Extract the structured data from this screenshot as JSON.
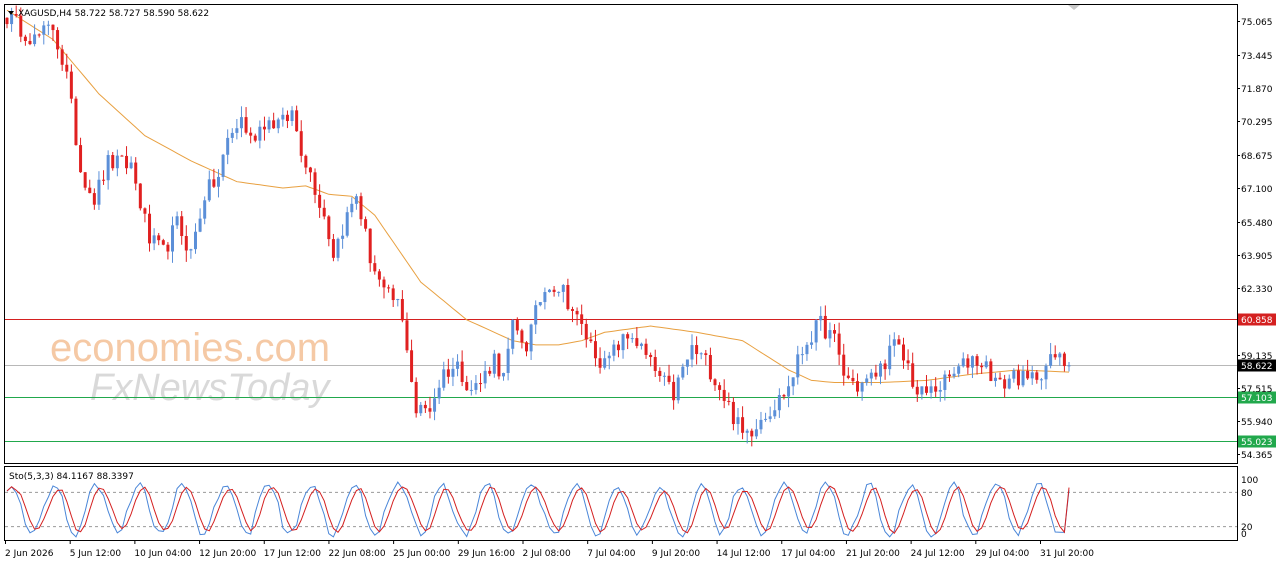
{
  "header": {
    "symbol_line": "XAGUSD,H4  58.722 58.727 58.590 58.622"
  },
  "watermark": {
    "line1": "economies.com",
    "line2": "FxNewsToday"
  },
  "colors": {
    "bull": "#5b8fd8",
    "bear": "#e02020",
    "ma": "#e8a040",
    "resistance": "#d42020",
    "support": "#21a84c",
    "stoch_main": "#4a86d8",
    "stoch_signal": "#d42020"
  },
  "chart_data": [
    {
      "type": "candlestick",
      "symbol": "XAGUSD",
      "timeframe": "H4",
      "ohlc_header": {
        "open": 58.722,
        "high": 58.727,
        "low": 58.59,
        "close": 58.622
      },
      "y_ticks": [
        75.065,
        73.445,
        71.87,
        70.295,
        68.675,
        67.1,
        65.48,
        63.905,
        62.33,
        59.135,
        57.515,
        55.94,
        54.365
      ],
      "ylim": [
        54.0,
        75.8
      ],
      "x_tick_labels": [
        "2 Jun 2026",
        "5 Jun 12:00",
        "10 Jun 04:00",
        "12 Jun 20:00",
        "17 Jun 12:00",
        "22 Jun 08:00",
        "25 Jun 00:00",
        "29 Jun 16:00",
        "2 Jul 08:00",
        "7 Jul 04:00",
        "9 Jul 20:00",
        "14 Jul 12:00",
        "17 Jul 04:00",
        "21 Jul 20:00",
        "24 Jul 12:00",
        "29 Jul 04:00",
        "31 Jul 20:00"
      ],
      "price_levels": [
        {
          "label": "60.858",
          "value": 60.858,
          "kind": "resistance"
        },
        {
          "label": "58.622",
          "value": 58.622,
          "kind": "current"
        },
        {
          "label": "57.103",
          "value": 57.103,
          "kind": "support"
        },
        {
          "label": "55.023",
          "value": 55.023,
          "kind": "support"
        }
      ],
      "close_path": [
        [
          0,
          75.3
        ],
        [
          6,
          74.2
        ],
        [
          10,
          74.8
        ],
        [
          13,
          72.4
        ],
        [
          16,
          68.0
        ],
        [
          19,
          66.6
        ],
        [
          22,
          68.3
        ],
        [
          27,
          68.2
        ],
        [
          31,
          64.6
        ],
        [
          34,
          64.0
        ],
        [
          37,
          65.4
        ],
        [
          40,
          64.0
        ],
        [
          43,
          66.8
        ],
        [
          46,
          67.6
        ],
        [
          48,
          69.4
        ],
        [
          51,
          70.4
        ],
        [
          53,
          69.4
        ],
        [
          56,
          70.3
        ],
        [
          60,
          70.2
        ],
        [
          62,
          70.7
        ],
        [
          64,
          69.0
        ],
        [
          66,
          67.8
        ],
        [
          69,
          65.8
        ],
        [
          71,
          64.0
        ],
        [
          73,
          65.2
        ],
        [
          76,
          66.8
        ],
        [
          79,
          63.8
        ],
        [
          82,
          62.0
        ],
        [
          85,
          61.6
        ],
        [
          87,
          59.6
        ],
        [
          89,
          56.4
        ],
        [
          92,
          56.6
        ],
        [
          95,
          58.3
        ],
        [
          98,
          58.6
        ],
        [
          101,
          57.5
        ],
        [
          103,
          57.8
        ],
        [
          106,
          59.0
        ],
        [
          108,
          58.0
        ],
        [
          110,
          60.4
        ],
        [
          113,
          59.6
        ],
        [
          116,
          61.8
        ],
        [
          118,
          62.6
        ],
        [
          121,
          62.2
        ],
        [
          124,
          60.8
        ],
        [
          127,
          59.6
        ],
        [
          130,
          58.6
        ],
        [
          133,
          59.6
        ],
        [
          136,
          60.1
        ],
        [
          139,
          59.0
        ],
        [
          142,
          58.0
        ],
        [
          145,
          57.2
        ],
        [
          147,
          58.4
        ],
        [
          149,
          59.4
        ],
        [
          152,
          58.8
        ],
        [
          155,
          57.6
        ],
        [
          158,
          56.2
        ],
        [
          160,
          55.3
        ],
        [
          162,
          55.6
        ],
        [
          164,
          56.2
        ],
        [
          167,
          56.7
        ],
        [
          170,
          57.6
        ],
        [
          172,
          58.8
        ],
        [
          174,
          59.8
        ],
        [
          177,
          60.6
        ],
        [
          180,
          59.8
        ],
        [
          182,
          58.2
        ],
        [
          185,
          57.6
        ],
        [
          188,
          58.0
        ],
        [
          190,
          58.5
        ],
        [
          193,
          59.6
        ],
        [
          196,
          58.6
        ],
        [
          198,
          57.2
        ],
        [
          201,
          57.4
        ],
        [
          204,
          57.8
        ],
        [
          207,
          58.4
        ],
        [
          210,
          59.0
        ],
        [
          213,
          58.6
        ],
        [
          216,
          57.6
        ],
        [
          219,
          58.2
        ],
        [
          222,
          57.8
        ],
        [
          225,
          58.4
        ],
        [
          228,
          59.0
        ],
        [
          231,
          58.622
        ]
      ],
      "moving_average": [
        [
          0,
          75.6
        ],
        [
          10,
          74.2
        ],
        [
          20,
          71.6
        ],
        [
          30,
          69.6
        ],
        [
          40,
          68.4
        ],
        [
          50,
          67.4
        ],
        [
          60,
          67.1
        ],
        [
          65,
          67.2
        ],
        [
          70,
          66.8
        ],
        [
          75,
          66.7
        ],
        [
          80,
          65.8
        ],
        [
          90,
          62.6
        ],
        [
          100,
          60.8
        ],
        [
          110,
          59.8
        ],
        [
          115,
          59.6
        ],
        [
          120,
          59.6
        ],
        [
          125,
          59.8
        ],
        [
          130,
          60.2
        ],
        [
          140,
          60.5
        ],
        [
          150,
          60.2
        ],
        [
          160,
          59.8
        ],
        [
          170,
          58.4
        ],
        [
          175,
          57.9
        ],
        [
          180,
          57.8
        ],
        [
          190,
          57.8
        ],
        [
          200,
          57.9
        ],
        [
          210,
          58.2
        ],
        [
          220,
          58.4
        ],
        [
          231,
          58.3
        ]
      ],
      "candle_count": 232
    },
    {
      "type": "line",
      "name": "Sto(5,3,3)",
      "header": "Sto(5,3,3) 84.1167 88.3397",
      "main_value": 84.1167,
      "signal_value": 88.3397,
      "y_ticks": [
        100,
        80,
        20,
        0
      ],
      "levels": [
        80,
        20
      ],
      "ylim": [
        0,
        100
      ]
    }
  ]
}
